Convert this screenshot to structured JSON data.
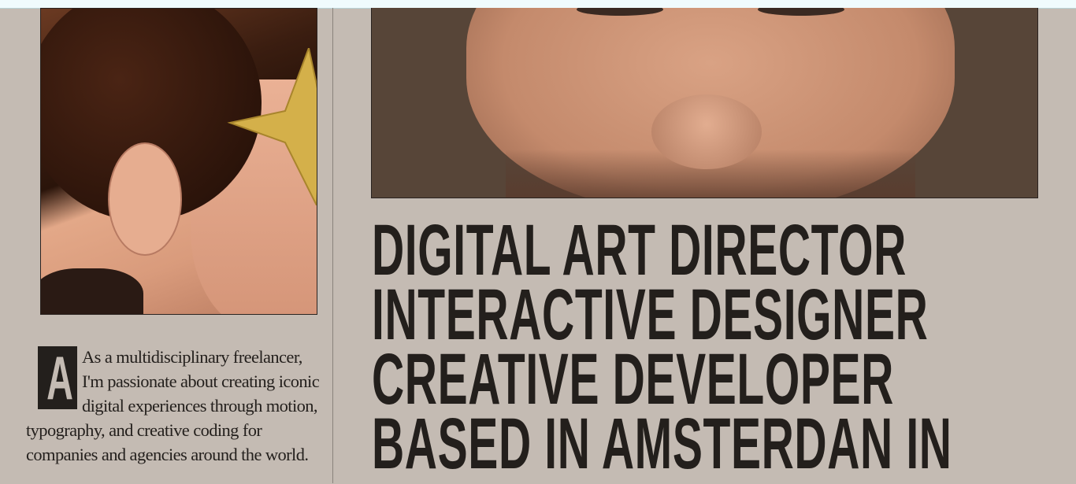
{
  "headline": {
    "lines": [
      "DIGITAL ART DIRECTOR",
      "INTERACTIVE DESIGNER",
      "CREATIVE DEVELOPER",
      "BASED IN AMSTERDAN IN"
    ]
  },
  "intro": {
    "dropcap": "A",
    "text": "As a multidisciplinary freelancer, I'm passionate about creating iconic digital experiences through motion, typography, and creative coding for companies and agencies around the world."
  },
  "colors": {
    "background": "#c4bbb3",
    "text": "#231f1c",
    "star": "#d4b04a"
  }
}
